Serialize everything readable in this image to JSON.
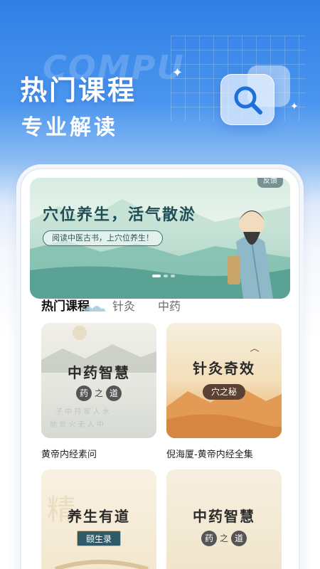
{
  "promo": {
    "bg_word": "COMPU",
    "title": "热门课程",
    "subtitle": "专业解读"
  },
  "colors": {
    "brand_blue": "#2f7fe6",
    "banner_teal": "#1f4e55",
    "card_cream": "#f3ead6",
    "card_orange": "#e9a25a"
  },
  "icons": {
    "search": "search-icon",
    "sparkle": "sparkle-icon"
  },
  "banner": {
    "title": "穴位养生，活气散淤",
    "subtitle": "阅读中医古书，上穴位养生！",
    "badge": "反馈"
  },
  "tabs": [
    {
      "label": "热门课程",
      "active": true
    },
    {
      "label": "针灸",
      "active": false
    },
    {
      "label": "中药",
      "active": false
    }
  ],
  "courses": [
    {
      "thumb_title": "中药智慧",
      "seal_a": "药",
      "seal_mid": "之",
      "seal_b": "道",
      "caption": "黄帝内经素问"
    },
    {
      "thumb_title": "针灸奇效",
      "tag": "穴之秘",
      "caption": "倪海厦-黄帝内经全集"
    },
    {
      "thumb_title": "养生有道",
      "tag": "颐生录",
      "caption": ""
    },
    {
      "thumb_title": "中药智慧",
      "seal_a": "药",
      "seal_mid": "之",
      "seal_b": "道",
      "caption": ""
    }
  ]
}
